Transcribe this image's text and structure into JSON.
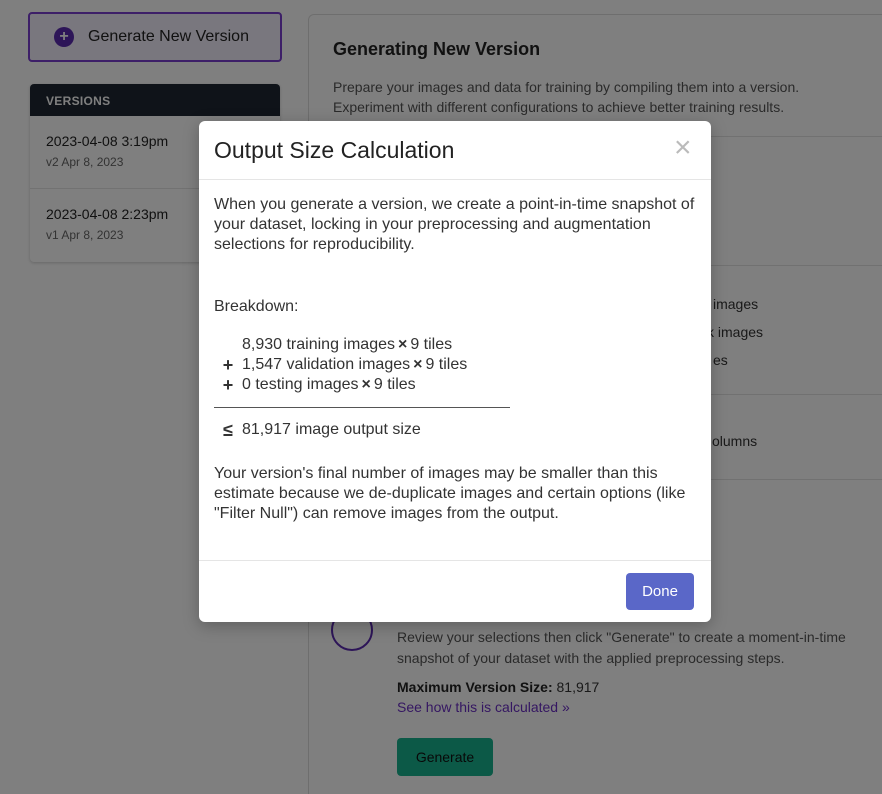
{
  "sidebar": {
    "generate_button_label": "Generate New Version",
    "versions_header": "VERSIONS",
    "versions": [
      {
        "title": "2023-04-08 3:19pm",
        "subtitle": "v2 Apr 8, 2023"
      },
      {
        "title": "2023-04-08 2:23pm",
        "subtitle": "v1 Apr 8, 2023"
      }
    ]
  },
  "main": {
    "title": "Generating New Version",
    "description": "Prepare your images and data for training by compiling them into a version. Experiment with different configurations to achieve better training results.",
    "peek_1": "images",
    "peek_2": "k images",
    "peek_3": "es",
    "peek_4": "olumns",
    "generate_description": "Review your selections then click \"Generate\" to create a moment-in-time snapshot of your dataset with the applied preprocessing steps.",
    "max_size_label": "Maximum Version Size:",
    "max_size_value": "81,917",
    "see_how_link": "See how this is calculated »",
    "generate_button": "Generate"
  },
  "modal": {
    "title": "Output Size Calculation",
    "close_glyph": "×",
    "intro": "When you generate a version, we create a point-in-time snapshot of your dataset, locking in your preprocessing and augmentation selections for reproducibility.",
    "breakdown_label": "Breakdown:",
    "rows": [
      {
        "op": "",
        "text": "8,930 training images",
        "times": "×",
        "tiles": "9 tiles"
      },
      {
        "op": "+",
        "text": "1,547 validation images",
        "times": "×",
        "tiles": "9 tiles"
      },
      {
        "op": "+",
        "text": "0 testing images",
        "times": "×",
        "tiles": "9 tiles"
      }
    ],
    "total_op": "≤",
    "total_text": "81,917 image output size",
    "note": "Your version's final number of images may be smaller than this estimate because we de-duplicate images and certain options (like \"Filter Null\") can remove images from the output.",
    "done_button": "Done"
  },
  "colors": {
    "accent_purple": "#5b2bb0",
    "done_button": "#5a67c8",
    "generate_button": "#19b38e",
    "versions_header_bg": "#1f2733"
  }
}
